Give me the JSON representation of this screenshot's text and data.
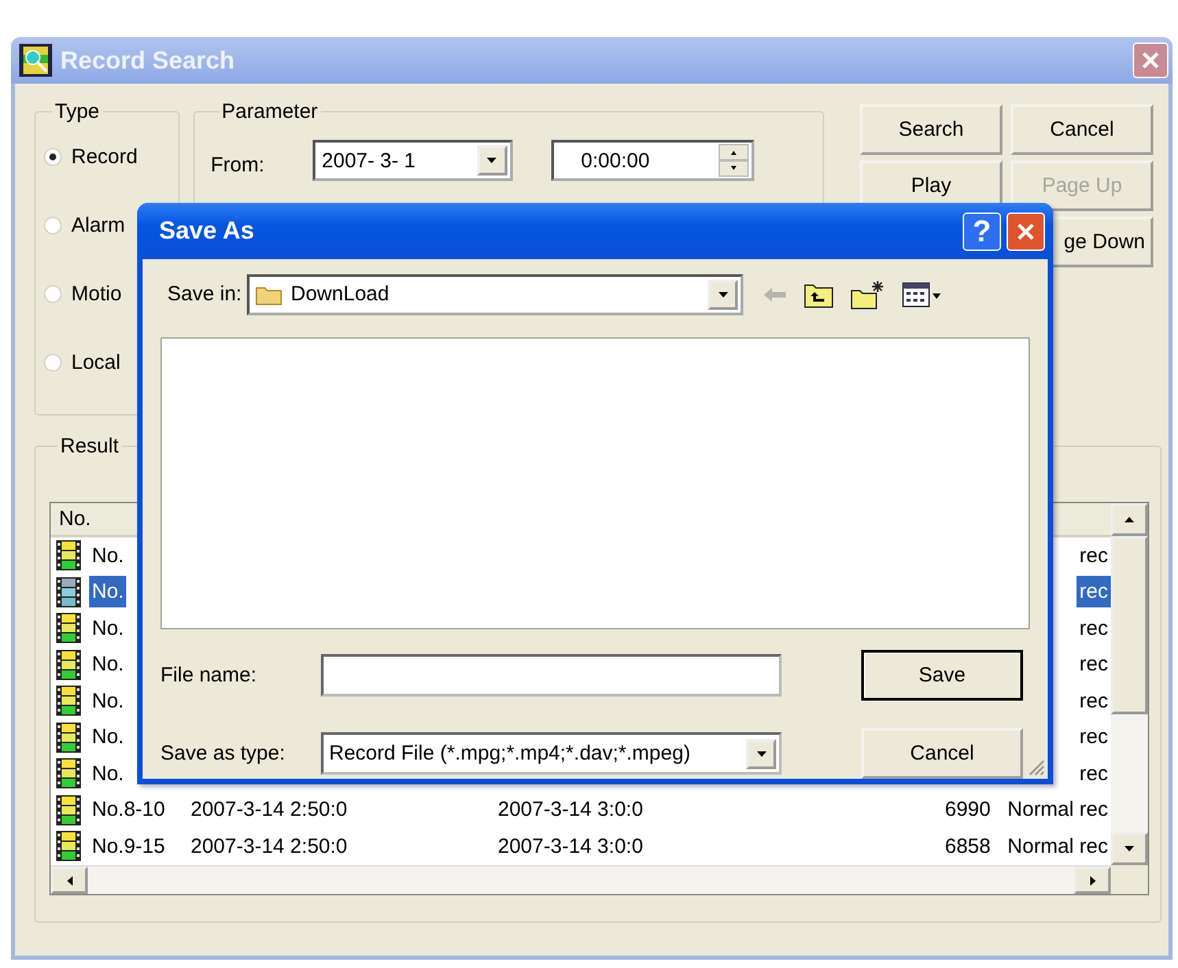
{
  "window": {
    "title": "Record Search"
  },
  "type_group": {
    "label": "Type",
    "options": [
      {
        "label": "Record",
        "selected": true
      },
      {
        "label": "Alarm",
        "selected": false
      },
      {
        "label": "Motio",
        "selected": false
      },
      {
        "label": "Local",
        "selected": false
      }
    ]
  },
  "parameter_group": {
    "label": "Parameter",
    "from_label": "From:",
    "date": "2007- 3- 1",
    "time": "0:00:00"
  },
  "buttons": [
    {
      "label": "Search",
      "disabled": false
    },
    {
      "label": "Cancel",
      "disabled": false
    },
    {
      "label": "Play",
      "disabled": false
    },
    {
      "label": "Page Up",
      "disabled": true
    },
    {
      "label": "ge Down",
      "disabled": false
    }
  ],
  "result_group": {
    "label": "Result",
    "columns": [
      "No."
    ],
    "rows": [
      {
        "no": "No.",
        "type": "rec",
        "selected": false
      },
      {
        "no": "No.",
        "type": "rec",
        "selected": true
      },
      {
        "no": "No.",
        "type": "rec",
        "selected": false
      },
      {
        "no": "No.",
        "type": "rec",
        "selected": false
      },
      {
        "no": "No.",
        "type": "rec",
        "selected": false
      },
      {
        "no": "No.",
        "type": "rec",
        "selected": false
      },
      {
        "no": "No.",
        "type": "rec",
        "selected": false
      },
      {
        "no": "No.8-10",
        "start": "2007-3-14 2:50:0",
        "end": "2007-3-14 3:0:0",
        "size": "6990",
        "type": "Normal rec",
        "selected": false
      },
      {
        "no": "No.9-15",
        "start": "2007-3-14 2:50:0",
        "end": "2007-3-14 3:0:0",
        "size": "6858",
        "type": "Normal rec",
        "selected": false
      }
    ]
  },
  "dialog": {
    "title": "Save As",
    "help_glyph": "?",
    "save_in_label": "Save in:",
    "save_in": "DownLoad",
    "file_name_label": "File name:",
    "save_as_type_label": "Save as type:",
    "save_as_type": "Record File (*.mpg;*.mp4;*.dav;*.mpeg)",
    "buttons": [
      {
        "label": "Save",
        "default": true
      },
      {
        "label": "Cancel",
        "default": false
      }
    ]
  }
}
